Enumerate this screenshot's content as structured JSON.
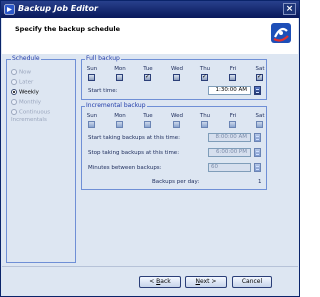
{
  "window": {
    "title": "Backup Job Editor",
    "close_symbol": "×"
  },
  "header": {
    "title": "Specify the backup schedule"
  },
  "schedule": {
    "label": "Schedule",
    "options": [
      {
        "label": "Now",
        "selected": false,
        "enabled": false
      },
      {
        "label": "Later",
        "selected": false,
        "enabled": false
      },
      {
        "label": "Weekly",
        "selected": true,
        "enabled": true
      },
      {
        "label": "Monthly",
        "selected": false,
        "enabled": false
      },
      {
        "label": "Continuous Incrementals",
        "selected": false,
        "enabled": false
      }
    ]
  },
  "full_backup": {
    "label": "Full backup",
    "days": [
      "Sun",
      "Mon",
      "Tue",
      "Wed",
      "Thu",
      "Fri",
      "Sat"
    ],
    "checked": [
      false,
      false,
      true,
      false,
      true,
      false,
      true
    ],
    "start_time_label": "Start time:",
    "start_time": "1:30:00 AM"
  },
  "incremental_backup": {
    "label": "Incremental backup",
    "days": [
      "Sun",
      "Mon",
      "Tue",
      "Wed",
      "Thu",
      "Fri",
      "Sat"
    ],
    "checked": [
      false,
      false,
      false,
      false,
      false,
      false,
      false
    ],
    "start_label": "Start taking backups at this time:",
    "start_time": "8:00:00 AM",
    "stop_label": "Stop taking backups at this time:",
    "stop_time": "6:00:00 PM",
    "minutes_label": "Minutes between backups:",
    "minutes": "60",
    "per_day_label": "Backups per day:",
    "per_day": "1"
  },
  "buttons": {
    "back": {
      "prefix": "< ",
      "key": "B",
      "rest": "ack"
    },
    "next": {
      "key": "N",
      "rest": "ext >"
    },
    "cancel": {
      "label": "Cancel"
    }
  },
  "colors": {
    "title_bar": "#08185a",
    "accent": "#1f3aa8",
    "background": "#dde6f2"
  }
}
